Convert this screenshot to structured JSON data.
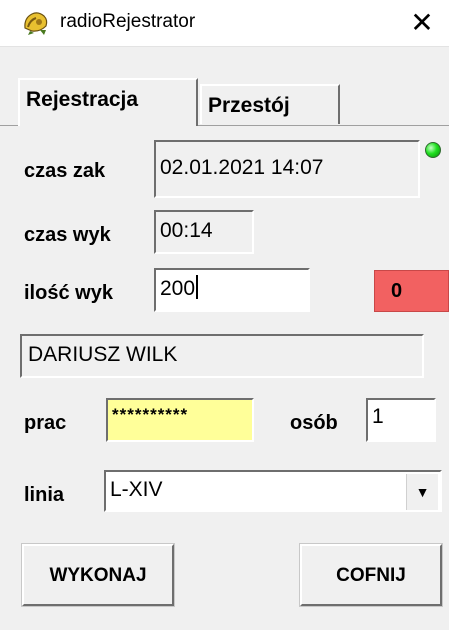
{
  "window": {
    "title": "radioRejestrator",
    "app_icon": "radio-icon",
    "close_glyph": "✕"
  },
  "tabs": [
    {
      "label": "Rejestracja",
      "active": true
    },
    {
      "label": "Przestój",
      "active": false
    }
  ],
  "czas_zak": {
    "label": "czas zak",
    "value": "02.01.2021   14:07"
  },
  "status_led": {
    "color": "#20e020"
  },
  "czas_wyk": {
    "label": "czas wyk",
    "value": "00:14"
  },
  "ilosc_wyk": {
    "label": "ilość wyk",
    "value": "200"
  },
  "counter": {
    "value": "0",
    "color": "#f26161"
  },
  "worker_name": {
    "value": "DARIUSZ WILK"
  },
  "prac": {
    "label": "prac",
    "value": "**********",
    "bg_color": "#ffff99"
  },
  "osob": {
    "label": "osób",
    "value": "1"
  },
  "linia": {
    "label": "linia",
    "value": "L-XIV"
  },
  "buttons": {
    "execute": "WYKONAJ",
    "back": "COFNIJ"
  }
}
